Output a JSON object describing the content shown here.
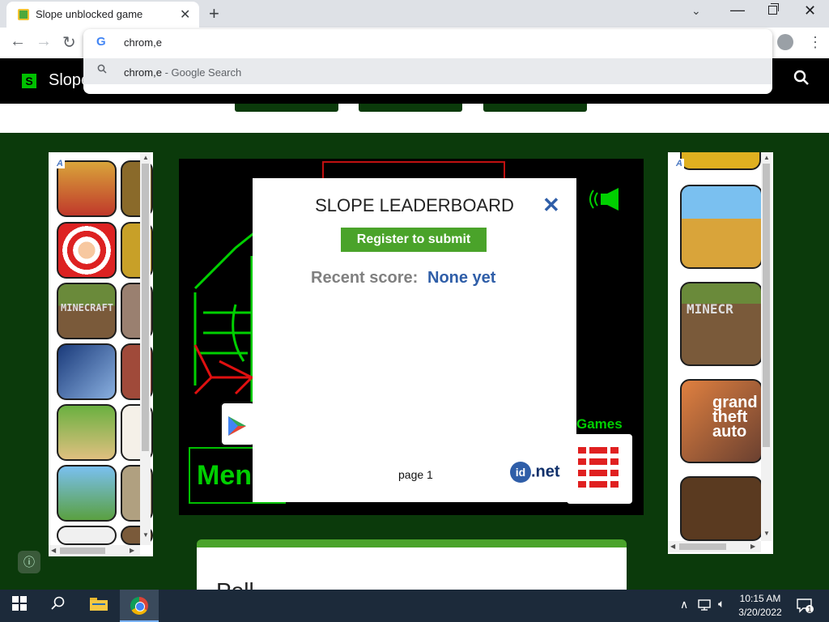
{
  "browser": {
    "tab_title": "Slope unblocked game",
    "new_tab_label": "+",
    "omnibox_value": "chrom,e",
    "suggestion_query": "chrom,e",
    "suggestion_desc": " - Google Search"
  },
  "site": {
    "name": "Slope",
    "logo_letter": "S"
  },
  "leaderboard": {
    "title": "SLOPE LEADERBOARD",
    "close_glyph": "✕",
    "register_label": "Register to submit",
    "recent_label": "Recent score:",
    "recent_value": "None yet",
    "page_label": "page 1",
    "idnet_prefix": "id",
    "idnet_suffix": ".net"
  },
  "game": {
    "games_text": "Games",
    "menu_text": "Men"
  },
  "poll": {
    "title": "Poll"
  },
  "taskbar": {
    "time": "10:15 AM",
    "date": "3/20/2022",
    "notification_count": "1"
  },
  "colors": {
    "page_bg": "#0b3a0b",
    "accent_green": "#4aa32a",
    "link_blue": "#2f5ea8"
  }
}
